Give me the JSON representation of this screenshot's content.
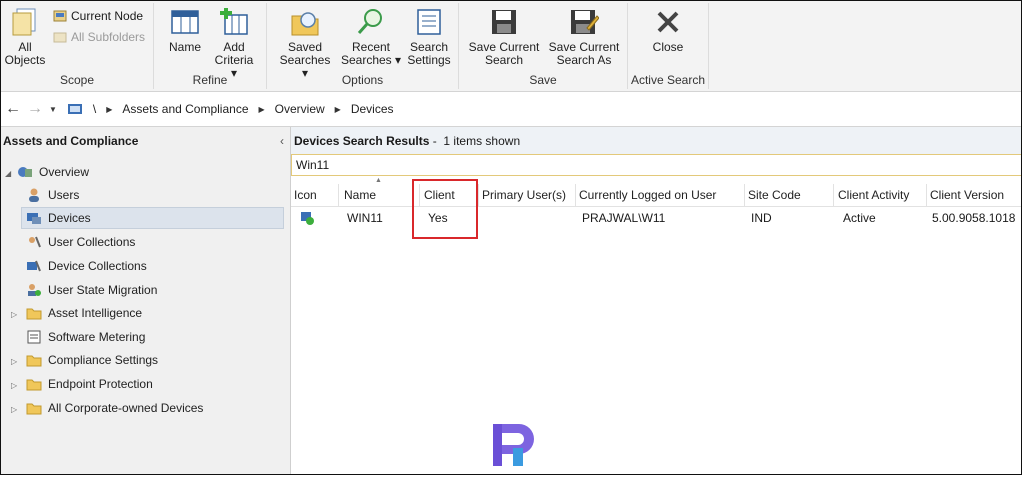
{
  "ribbon": {
    "scope": {
      "all_objects": "All\nObjects",
      "current_node": "Current Node",
      "all_subfolders": "All Subfolders",
      "label": "Scope"
    },
    "refine": {
      "name": "Name",
      "add_criteria": "Add\nCriteria ▾",
      "label": "Refine"
    },
    "options": {
      "saved_searches": "Saved\nSearches ▾",
      "recent_searches": "Recent\nSearches ▾",
      "search_settings": "Search\nSettings",
      "label": "Options"
    },
    "save": {
      "save_current_search": "Save Current\nSearch",
      "save_current_search_as": "Save Current\nSearch As",
      "label": "Save"
    },
    "active_search": {
      "close": "Close",
      "label": "Active Search"
    }
  },
  "address": {
    "root": "\\",
    "crumbs": [
      "Assets and Compliance",
      "Overview",
      "Devices"
    ]
  },
  "left": {
    "title": "Assets and Compliance",
    "collapse": "‹",
    "items": [
      {
        "label": "Overview"
      },
      {
        "label": "Users"
      },
      {
        "label": "Devices"
      },
      {
        "label": "User Collections"
      },
      {
        "label": "Device Collections"
      },
      {
        "label": "User State Migration"
      },
      {
        "label": "Asset Intelligence"
      },
      {
        "label": "Software Metering"
      },
      {
        "label": "Compliance Settings"
      },
      {
        "label": "Endpoint Protection"
      },
      {
        "label": "All Corporate-owned Devices"
      }
    ]
  },
  "results": {
    "title": "Devices Search Results",
    "count": " -  1 items shown",
    "search_value": "Win11",
    "columns": [
      "Icon",
      "Name",
      "Client",
      "Primary User(s)",
      "Currently Logged on User",
      "Site Code",
      "Client Activity",
      "Client Version"
    ],
    "rows": [
      {
        "name": "WIN11",
        "client": "Yes",
        "primary_user": "",
        "logged_on": "PRAJWAL\\W11",
        "site_code": "IND",
        "activity": "Active",
        "version": "5.00.9058.1018"
      }
    ]
  },
  "colors": {
    "highlight": "#d9282b",
    "logo": "#6a4fd6"
  }
}
